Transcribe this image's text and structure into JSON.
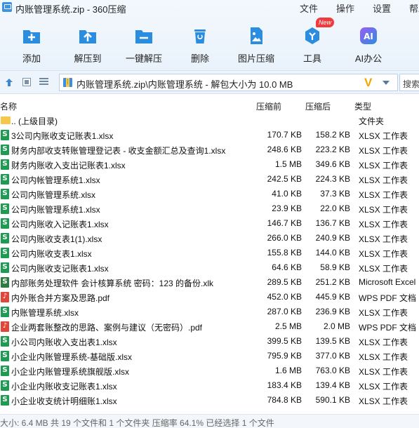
{
  "window": {
    "title": "内账管理系统.zip - 360压缩",
    "menu": [
      "文件",
      "操作",
      "设置",
      "帮助"
    ]
  },
  "toolbar": {
    "items": [
      {
        "label": "添加",
        "icon": "add-icon"
      },
      {
        "label": "解压到",
        "icon": "extract-icon"
      },
      {
        "label": "一键解压",
        "icon": "one-click-extract-icon"
      },
      {
        "label": "删除",
        "icon": "delete-icon"
      },
      {
        "label": "图片压缩",
        "icon": "image-compress-icon"
      },
      {
        "label": "工具",
        "icon": "tools-icon"
      },
      {
        "label": "AI办公",
        "icon": "ai-office-icon"
      }
    ],
    "badge": "New"
  },
  "address": {
    "path": "内账管理系统.zip\\内账管理系统 - 解包大小为 10.0 MB",
    "search_placeholder": "搜索"
  },
  "columns": {
    "name": "名称",
    "compressed_before": "压缩前",
    "compressed_after": "压缩后",
    "type": "类型"
  },
  "files": [
    {
      "name": ".. (上级目录)",
      "before": "",
      "after": "",
      "type": "文件夹",
      "icon": "folder"
    },
    {
      "name": "3公司内账收支记账表1.xlsx",
      "before": "170.7 KB",
      "after": "158.2 KB",
      "type": "XLSX 工作表",
      "icon": "xlsx"
    },
    {
      "name": "财务内部收支转账管理登记表 - 收支金额汇总及查询1.xlsx",
      "before": "248.6 KB",
      "after": "223.2 KB",
      "type": "XLSX 工作表",
      "icon": "xlsx"
    },
    {
      "name": "财务内账收入支出记账表1.xlsx",
      "before": "1.5 MB",
      "after": "349.6 KB",
      "type": "XLSX 工作表",
      "icon": "xlsx"
    },
    {
      "name": "公司内帐管理系统1.xlsx",
      "before": "242.5 KB",
      "after": "224.3 KB",
      "type": "XLSX 工作表",
      "icon": "xlsx"
    },
    {
      "name": "公司内账管理系统.xlsx",
      "before": "41.0 KB",
      "after": "37.3 KB",
      "type": "XLSX 工作表",
      "icon": "xlsx"
    },
    {
      "name": "公司内账管理系统1.xlsx",
      "before": "23.9 KB",
      "after": "22.0 KB",
      "type": "XLSX 工作表",
      "icon": "xlsx"
    },
    {
      "name": "公司内账收入记账表1.xlsx",
      "before": "146.7 KB",
      "after": "136.7 KB",
      "type": "XLSX 工作表",
      "icon": "xlsx"
    },
    {
      "name": "公司内账收支表1(1).xlsx",
      "before": "266.0 KB",
      "after": "240.9 KB",
      "type": "XLSX 工作表",
      "icon": "xlsx"
    },
    {
      "name": "公司内账收支表1.xlsx",
      "before": "155.8 KB",
      "after": "144.0 KB",
      "type": "XLSX 工作表",
      "icon": "xlsx"
    },
    {
      "name": "公司内账收支记账表1.xlsx",
      "before": "64.6 KB",
      "after": "58.9 KB",
      "type": "XLSX 工作表",
      "icon": "xlsx"
    },
    {
      "name": "内部账务处理软件 会计核算系统 密码：123 的备份.xlk",
      "before": "289.5 KB",
      "after": "251.2 KB",
      "type": "Microsoft Excel",
      "icon": "xlk"
    },
    {
      "name": "内外账合并方案及思路.pdf",
      "before": "452.0 KB",
      "after": "445.9 KB",
      "type": "WPS PDF 文档",
      "icon": "pdf"
    },
    {
      "name": "内账管理系统.xlsx",
      "before": "287.0 KB",
      "after": "236.9 KB",
      "type": "XLSX 工作表",
      "icon": "xlsx"
    },
    {
      "name": "企业两套账整改的思路、案例与建议（无密码）.pdf",
      "before": "2.5 MB",
      "after": "2.0 MB",
      "type": "WPS PDF 文档",
      "icon": "pdf"
    },
    {
      "name": "小公司内账收入支出表1.xlsx",
      "before": "399.5 KB",
      "after": "139.5 KB",
      "type": "XLSX 工作表",
      "icon": "xlsx"
    },
    {
      "name": "小企业内账管理系统-基础版.xlsx",
      "before": "795.9 KB",
      "after": "377.0 KB",
      "type": "XLSX 工作表",
      "icon": "xlsx"
    },
    {
      "name": "小企业内账管理系统旗舰版.xlsx",
      "before": "1.6 MB",
      "after": "763.0 KB",
      "type": "XLSX 工作表",
      "icon": "xlsx"
    },
    {
      "name": "小企业内账收支记账表1.xlsx",
      "before": "183.4 KB",
      "after": "139.4 KB",
      "type": "XLSX 工作表",
      "icon": "xlsx"
    },
    {
      "name": "小企业收支统计明细账1.xlsx",
      "before": "784.8 KB",
      "after": "590.1 KB",
      "type": "XLSX 工作表",
      "icon": "xlsx"
    }
  ],
  "status": "大小: 6.4 MB 共 19 个文件和 1 个文件夹 压缩率 64.1% 已经选择 1 个文件",
  "colors": {
    "xlsx": "#1f9a52",
    "pdf": "#e0463a",
    "xlk": "#2f7a3d",
    "folder": "#f5c74a",
    "accent": "#2b8de0"
  }
}
